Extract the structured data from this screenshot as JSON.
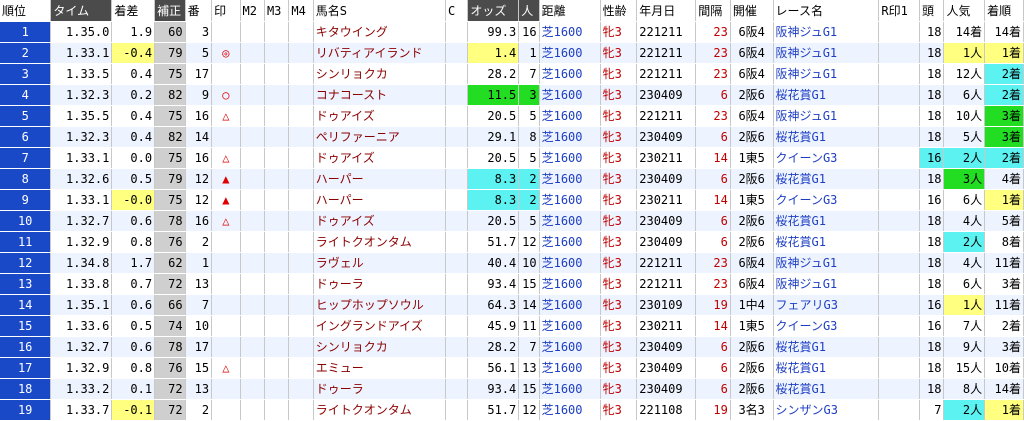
{
  "columns": [
    "順位",
    "タイム",
    "着差",
    "補正",
    "番",
    "印",
    "M2",
    "M3",
    "M4",
    "馬名S",
    "C",
    "オッズ",
    "人",
    "距離",
    "性齢",
    "年月日",
    "間隔",
    "開催",
    "レース名",
    "R印1",
    "頭",
    "人気",
    "着順"
  ],
  "colors": {
    "rank_bg": "#1a49c8",
    "yellow": "#ffff80",
    "green": "#22dd22",
    "cyan": "#5df2f2",
    "hose": "#cfcfcf"
  },
  "rows": [
    {
      "rank": "1",
      "time": "1.35.0",
      "diff": "1.9",
      "hosei": "60",
      "ban": "3",
      "mark": "",
      "horse": "キタウイング",
      "odds": "99.3",
      "nin": "16",
      "dist": "芝1600",
      "sex": "牝3",
      "date": "221211",
      "kan": "23",
      "kaisai": "6阪4",
      "race": "阪神ジュG1",
      "tou": "18",
      "ninki": "14着",
      "chaku": "14着",
      "hl": {}
    },
    {
      "rank": "2",
      "time": "1.33.1",
      "diff": "-0.4",
      "hosei": "79",
      "ban": "5",
      "mark": "◎",
      "horse": "リバティアイランド",
      "odds": "1.4",
      "nin": "1",
      "dist": "芝1600",
      "sex": "牝3",
      "date": "221211",
      "kan": "23",
      "kaisai": "6阪4",
      "race": "阪神ジュG1",
      "tou": "18",
      "ninki": "1人",
      "chaku": "1着",
      "hl": {
        "diff": "yellow",
        "odds": "yellow",
        "ninki": "yellow",
        "chaku": "yellow"
      }
    },
    {
      "rank": "3",
      "time": "1.33.5",
      "diff": "0.4",
      "hosei": "75",
      "ban": "17",
      "mark": "",
      "horse": "シンリョクカ",
      "odds": "28.2",
      "nin": "7",
      "dist": "芝1600",
      "sex": "牝3",
      "date": "221211",
      "kan": "23",
      "kaisai": "6阪4",
      "race": "阪神ジュG1",
      "tou": "18",
      "ninki": "12人",
      "chaku": "2着",
      "hl": {
        "chaku": "cyan"
      }
    },
    {
      "rank": "4",
      "time": "1.32.3",
      "diff": "0.2",
      "hosei": "82",
      "ban": "9",
      "mark": "○",
      "horse": "コナコースト",
      "odds": "11.5",
      "nin": "3",
      "dist": "芝1600",
      "sex": "牝3",
      "date": "230409",
      "kan": "6",
      "kaisai": "2阪6",
      "race": "桜花賞G1",
      "tou": "18",
      "ninki": "6人",
      "chaku": "2着",
      "hl": {
        "odds": "green",
        "nin": "green",
        "chaku": "cyan"
      }
    },
    {
      "rank": "5",
      "time": "1.35.5",
      "diff": "0.4",
      "hosei": "75",
      "ban": "16",
      "mark": "△",
      "horse": "ドゥアイズ",
      "odds": "20.5",
      "nin": "5",
      "dist": "芝1600",
      "sex": "牝3",
      "date": "221211",
      "kan": "23",
      "kaisai": "6阪4",
      "race": "阪神ジュG1",
      "tou": "18",
      "ninki": "10人",
      "chaku": "3着",
      "hl": {
        "chaku": "green"
      }
    },
    {
      "rank": "6",
      "time": "1.32.3",
      "diff": "0.4",
      "hosei": "82",
      "ban": "14",
      "mark": "",
      "horse": "ペリファーニア",
      "odds": "29.1",
      "nin": "8",
      "dist": "芝1600",
      "sex": "牝3",
      "date": "230409",
      "kan": "6",
      "kaisai": "2阪6",
      "race": "桜花賞G1",
      "tou": "18",
      "ninki": "5人",
      "chaku": "3着",
      "hl": {
        "chaku": "green"
      }
    },
    {
      "rank": "7",
      "time": "1.33.1",
      "diff": "0.0",
      "hosei": "75",
      "ban": "16",
      "mark": "△",
      "horse": "ドゥアイズ",
      "odds": "20.5",
      "nin": "5",
      "dist": "芝1600",
      "sex": "牝3",
      "date": "230211",
      "kan": "14",
      "kaisai": "1東5",
      "race": "クイーンG3",
      "tou": "16",
      "ninki": "2人",
      "chaku": "2着",
      "hl": {
        "tou": "cyan",
        "ninki": "cyan",
        "chaku": "cyan"
      }
    },
    {
      "rank": "8",
      "time": "1.32.6",
      "diff": "0.5",
      "hosei": "79",
      "ban": "12",
      "mark": "▲",
      "horse": "ハーパー",
      "odds": "8.3",
      "nin": "2",
      "dist": "芝1600",
      "sex": "牝3",
      "date": "230409",
      "kan": "6",
      "kaisai": "2阪6",
      "race": "桜花賞G1",
      "tou": "18",
      "ninki": "3人",
      "chaku": "4着",
      "hl": {
        "odds": "cyan",
        "nin": "cyan",
        "ninki": "green"
      }
    },
    {
      "rank": "9",
      "time": "1.33.1",
      "diff": "-0.0",
      "hosei": "75",
      "ban": "12",
      "mark": "▲",
      "horse": "ハーパー",
      "odds": "8.3",
      "nin": "2",
      "dist": "芝1600",
      "sex": "牝3",
      "date": "230211",
      "kan": "14",
      "kaisai": "1東5",
      "race": "クイーンG3",
      "tou": "16",
      "ninki": "6人",
      "chaku": "1着",
      "hl": {
        "diff": "yellow",
        "odds": "cyan",
        "nin": "cyan",
        "chaku": "yellow"
      }
    },
    {
      "rank": "10",
      "time": "1.32.7",
      "diff": "0.6",
      "hosei": "78",
      "ban": "16",
      "mark": "△",
      "horse": "ドゥアイズ",
      "odds": "20.5",
      "nin": "5",
      "dist": "芝1600",
      "sex": "牝3",
      "date": "230409",
      "kan": "6",
      "kaisai": "2阪6",
      "race": "桜花賞G1",
      "tou": "18",
      "ninki": "4人",
      "chaku": "5着",
      "hl": {}
    },
    {
      "rank": "11",
      "time": "1.32.9",
      "diff": "0.8",
      "hosei": "76",
      "ban": "2",
      "mark": "",
      "horse": "ライトクオンタム",
      "odds": "51.7",
      "nin": "12",
      "dist": "芝1600",
      "sex": "牝3",
      "date": "230409",
      "kan": "6",
      "kaisai": "2阪6",
      "race": "桜花賞G1",
      "tou": "18",
      "ninki": "2人",
      "chaku": "8着",
      "hl": {
        "ninki": "cyan"
      }
    },
    {
      "rank": "12",
      "time": "1.34.8",
      "diff": "1.7",
      "hosei": "62",
      "ban": "1",
      "mark": "",
      "horse": "ラヴェル",
      "odds": "40.4",
      "nin": "10",
      "dist": "芝1600",
      "sex": "牝3",
      "date": "221211",
      "kan": "23",
      "kaisai": "6阪4",
      "race": "阪神ジュG1",
      "tou": "18",
      "ninki": "4人",
      "chaku": "11着",
      "hl": {}
    },
    {
      "rank": "13",
      "time": "1.33.8",
      "diff": "0.7",
      "hosei": "72",
      "ban": "13",
      "mark": "",
      "horse": "ドゥーラ",
      "odds": "93.4",
      "nin": "15",
      "dist": "芝1600",
      "sex": "牝3",
      "date": "221211",
      "kan": "23",
      "kaisai": "6阪4",
      "race": "阪神ジュG1",
      "tou": "18",
      "ninki": "6人",
      "chaku": "3着",
      "hl": {}
    },
    {
      "rank": "14",
      "time": "1.35.1",
      "diff": "0.6",
      "hosei": "66",
      "ban": "7",
      "mark": "",
      "horse": "ヒップホップソウル",
      "odds": "64.3",
      "nin": "14",
      "dist": "芝1600",
      "sex": "牝3",
      "date": "230109",
      "kan": "19",
      "kaisai": "1中4",
      "race": "フェアリG3",
      "tou": "16",
      "ninki": "1人",
      "chaku": "11着",
      "hl": {
        "ninki": "yellow"
      }
    },
    {
      "rank": "15",
      "time": "1.33.6",
      "diff": "0.5",
      "hosei": "74",
      "ban": "10",
      "mark": "",
      "horse": "イングランドアイズ",
      "odds": "45.9",
      "nin": "11",
      "dist": "芝1600",
      "sex": "牝3",
      "date": "230211",
      "kan": "14",
      "kaisai": "1東5",
      "race": "クイーンG3",
      "tou": "16",
      "ninki": "7人",
      "chaku": "2着",
      "hl": {}
    },
    {
      "rank": "16",
      "time": "1.32.7",
      "diff": "0.6",
      "hosei": "78",
      "ban": "17",
      "mark": "",
      "horse": "シンリョクカ",
      "odds": "28.2",
      "nin": "7",
      "dist": "芝1600",
      "sex": "牝3",
      "date": "230409",
      "kan": "6",
      "kaisai": "2阪6",
      "race": "桜花賞G1",
      "tou": "18",
      "ninki": "9人",
      "chaku": "3着",
      "hl": {}
    },
    {
      "rank": "17",
      "time": "1.32.9",
      "diff": "0.8",
      "hosei": "76",
      "ban": "15",
      "mark": "△",
      "horse": "エミュー",
      "odds": "56.1",
      "nin": "13",
      "dist": "芝1600",
      "sex": "牝3",
      "date": "230409",
      "kan": "6",
      "kaisai": "2阪6",
      "race": "桜花賞G1",
      "tou": "18",
      "ninki": "15人",
      "chaku": "10着",
      "hl": {}
    },
    {
      "rank": "18",
      "time": "1.33.2",
      "diff": "0.1",
      "hosei": "72",
      "ban": "13",
      "mark": "",
      "horse": "ドゥーラ",
      "odds": "93.4",
      "nin": "15",
      "dist": "芝1600",
      "sex": "牝3",
      "date": "230409",
      "kan": "6",
      "kaisai": "2阪6",
      "race": "桜花賞G1",
      "tou": "18",
      "ninki": "8人",
      "chaku": "14着",
      "hl": {}
    },
    {
      "rank": "19",
      "time": "1.33.7",
      "diff": "-0.1",
      "hosei": "72",
      "ban": "2",
      "mark": "",
      "horse": "ライトクオンタム",
      "odds": "51.7",
      "nin": "12",
      "dist": "芝1600",
      "sex": "牝3",
      "date": "221108",
      "kan": "19",
      "kaisai": "3名3",
      "race": "シンザンG3",
      "tou": "7",
      "ninki": "2人",
      "chaku": "1着",
      "hl": {
        "diff": "yellow",
        "ninki": "cyan",
        "chaku": "yellow"
      }
    }
  ]
}
